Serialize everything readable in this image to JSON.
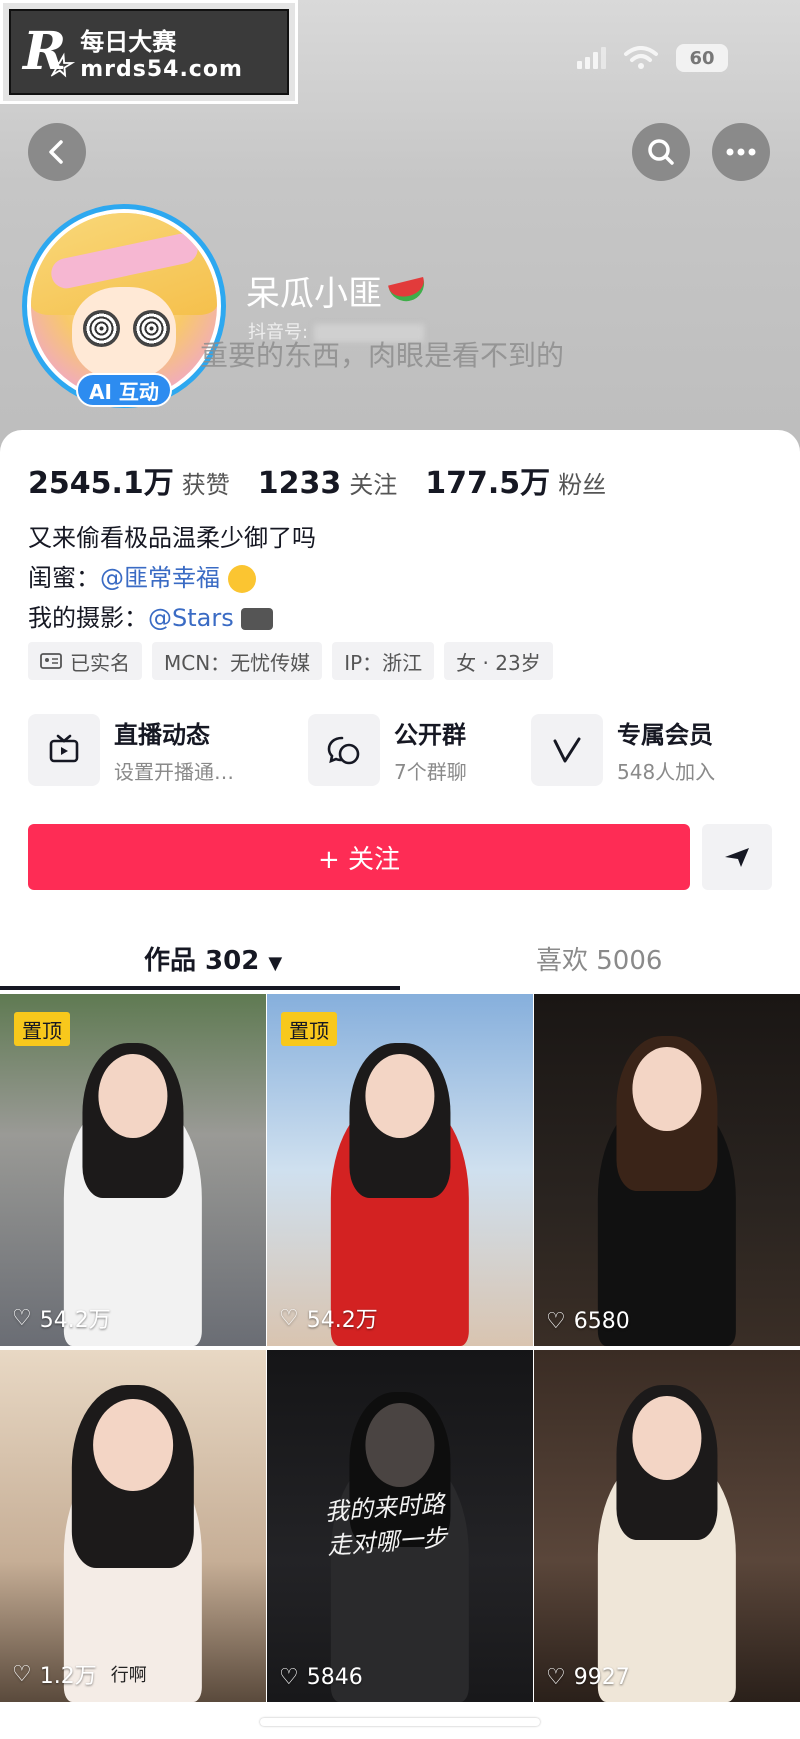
{
  "watermark": {
    "title": "每日大赛",
    "url": "mrds54.com",
    "logo": "R"
  },
  "status_bar": {
    "battery": "60"
  },
  "profile": {
    "name": "呆瓜小匪",
    "douyin_id_label": "抖音号:",
    "signature": "重要的东西，肉眼是看不到的",
    "ai_badge": "AI 互动"
  },
  "stats": [
    {
      "value": "2545.1万",
      "label": "获赞"
    },
    {
      "value": "1233",
      "label": "关注"
    },
    {
      "value": "177.5万",
      "label": "粉丝"
    }
  ],
  "bio": {
    "line1": "又来偷看极品温柔少御了吗",
    "line2_label": "闺蜜：",
    "line2_mention": "@匪常幸福",
    "line3_label": "我的摄影：",
    "line3_mention": "@Stars"
  },
  "tags": [
    "已实名",
    "MCN：无忧传媒",
    "IP：浙江",
    "女 · 23岁"
  ],
  "features": [
    {
      "icon": "tv-icon",
      "title": "直播动态",
      "sub": "设置开播通…"
    },
    {
      "icon": "chat-icon",
      "title": "公开群",
      "sub": "7个群聊"
    },
    {
      "icon": "v-icon",
      "title": "专属会员",
      "sub": "548人加入"
    }
  ],
  "follow_button": {
    "label": "+ 关注"
  },
  "tabs": {
    "works": "作品 302",
    "likes": "喜欢 5006"
  },
  "videos": [
    {
      "pinned": true,
      "pin_label": "置顶",
      "likes": "54.2万",
      "bg": "#8a9aa8"
    },
    {
      "pinned": true,
      "pin_label": "置顶",
      "likes": "54.2万",
      "bg": "#8fb4d8"
    },
    {
      "pinned": false,
      "likes": "6580",
      "bg": "#221c1a"
    },
    {
      "pinned": false,
      "likes": "1.2万",
      "bg": "#c8b4a0",
      "overlay_text": "行啊"
    },
    {
      "pinned": false,
      "likes": "5846",
      "bg": "#1b1b1d",
      "caption_line1": "我的来时路",
      "caption_line2": "走对哪一步"
    },
    {
      "pinned": false,
      "likes": "9927",
      "bg": "#4a3a32"
    }
  ],
  "colors": {
    "accent": "#fe2c55",
    "mention": "#3a6bc4",
    "avatar_ring": "#2da8f0",
    "pin": "#f8c81c"
  }
}
